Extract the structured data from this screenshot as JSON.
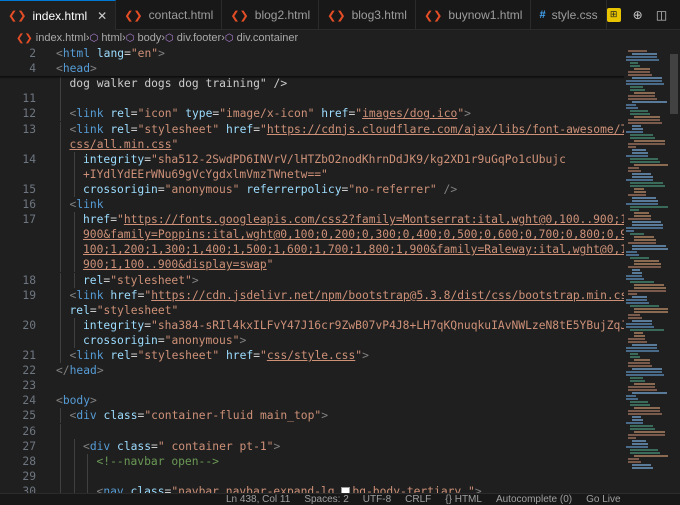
{
  "tabs": [
    {
      "label": "index.html",
      "icon": "html-file-icon",
      "glyph": "❮❯",
      "active": true
    },
    {
      "label": "contact.html",
      "icon": "html-file-icon",
      "glyph": "❮❯",
      "active": false
    },
    {
      "label": "blog2.html",
      "icon": "html-file-icon",
      "glyph": "❮❯",
      "active": false
    },
    {
      "label": "blog3.html",
      "icon": "html-file-icon",
      "glyph": "❮❯",
      "active": false
    },
    {
      "label": "buynow1.html",
      "icon": "html-file-icon",
      "glyph": "❮❯",
      "active": false
    },
    {
      "label": "style.css",
      "icon": "css-file-icon",
      "glyph": "#",
      "active": false
    }
  ],
  "tab_actions": {
    "highlight_glyph": "⊞",
    "globe_glyph": "⊕",
    "split_glyph": "◫",
    "more_glyph": "···"
  },
  "breadcrumb": [
    "index.html",
    "html",
    "body",
    "div.footer",
    "div.container"
  ],
  "status": {
    "position": "Ln 438, Col 11",
    "spaces": "Spaces: 2",
    "encoding": "UTF-8",
    "eol": "CRLF",
    "language": "{} HTML",
    "autocomplete": "Autocomplete (0)",
    "golive": "Go Live"
  },
  "colors": {
    "accent": "#0078d4",
    "tag": "#569cd6",
    "attr": "#9cdcfe",
    "string": "#ce9178",
    "comment": "#6a9955"
  },
  "lines": [
    {
      "n": "2",
      "indent": 0,
      "sticky": true,
      "tokens": [
        [
          "p",
          "<"
        ],
        [
          "t",
          "html"
        ],
        [
          "w",
          " "
        ],
        [
          "a",
          "lang"
        ],
        [
          "w",
          "="
        ],
        [
          "s",
          "\"en\""
        ],
        [
          "p",
          ">"
        ]
      ]
    },
    {
      "n": "4",
      "indent": 0,
      "sticky": true,
      "tokens": [
        [
          "p",
          "<"
        ],
        [
          "t",
          "head"
        ],
        [
          "p",
          ">"
        ]
      ]
    },
    {
      "n": "",
      "indent": 1,
      "tokens": [
        [
          "w",
          "dog walker dogs dog training\" />"
        ]
      ]
    },
    {
      "n": "11",
      "indent": 1,
      "tokens": []
    },
    {
      "n": "12",
      "indent": 1,
      "tokens": [
        [
          "p",
          "<"
        ],
        [
          "t",
          "link"
        ],
        [
          "w",
          " "
        ],
        [
          "a",
          "rel"
        ],
        [
          "w",
          "="
        ],
        [
          "s",
          "\"icon\""
        ],
        [
          "w",
          " "
        ],
        [
          "a",
          "type"
        ],
        [
          "w",
          "="
        ],
        [
          "s",
          "\"image/x-icon\""
        ],
        [
          "w",
          " "
        ],
        [
          "a",
          "href"
        ],
        [
          "w",
          "="
        ],
        [
          "s",
          "\""
        ],
        [
          "u",
          "images/dog.ico"
        ],
        [
          "s",
          "\""
        ],
        [
          "p",
          ">"
        ]
      ]
    },
    {
      "n": "13",
      "indent": 1,
      "tokens": [
        [
          "p",
          "<"
        ],
        [
          "t",
          "link"
        ],
        [
          "w",
          " "
        ],
        [
          "a",
          "rel"
        ],
        [
          "w",
          "="
        ],
        [
          "s",
          "\"stylesheet\""
        ],
        [
          "w",
          " "
        ],
        [
          "a",
          "href"
        ],
        [
          "w",
          "="
        ],
        [
          "s",
          "\""
        ],
        [
          "u",
          "https://cdnjs.cloudflare.com/ajax/libs/font-awesome/7.0.1/"
        ]
      ]
    },
    {
      "n": "",
      "indent": 1,
      "tokens": [
        [
          "u",
          "css/all.min.css"
        ],
        [
          "s",
          "\""
        ]
      ]
    },
    {
      "n": "14",
      "indent": 2,
      "tokens": [
        [
          "a",
          "integrity"
        ],
        [
          "w",
          "="
        ],
        [
          "s",
          "\"sha512-2SwdPD6INVrV/lHTZbO2nodKhrnDdJK9/kg2XD1r9uGqPo1cUbujc"
        ]
      ]
    },
    {
      "n": "",
      "indent": 2,
      "tokens": [
        [
          "s",
          "+IYdlYdEErWNu69gVcYgdxlmVmzTWnetw==\""
        ]
      ]
    },
    {
      "n": "15",
      "indent": 2,
      "tokens": [
        [
          "a",
          "crossorigin"
        ],
        [
          "w",
          "="
        ],
        [
          "s",
          "\"anonymous\""
        ],
        [
          "w",
          " "
        ],
        [
          "a",
          "referrerpolicy"
        ],
        [
          "w",
          "="
        ],
        [
          "s",
          "\"no-referrer\""
        ],
        [
          "w",
          " "
        ],
        [
          "p",
          "/>"
        ]
      ]
    },
    {
      "n": "16",
      "indent": 1,
      "tokens": [
        [
          "p",
          "<"
        ],
        [
          "t",
          "link"
        ]
      ]
    },
    {
      "n": "17",
      "indent": 2,
      "tokens": [
        [
          "a",
          "href"
        ],
        [
          "w",
          "="
        ],
        [
          "s",
          "\""
        ],
        [
          "u",
          "https://fonts.googleapis.com/css2?family=Montserrat:ital,wght@0,100..900;1,100.."
        ]
      ]
    },
    {
      "n": "",
      "indent": 2,
      "tokens": [
        [
          "u",
          "900&family=Poppins:ital,wght@0,100;0,200;0,300;0,400;0,500;0,600;0,700;0,800;0,900;1,"
        ]
      ]
    },
    {
      "n": "",
      "indent": 2,
      "tokens": [
        [
          "u",
          "100;1,200;1,300;1,400;1,500;1,600;1,700;1,800;1,900&family=Raleway:ital,wght@0,100.."
        ]
      ]
    },
    {
      "n": "",
      "indent": 2,
      "tokens": [
        [
          "u",
          "900;1,100..900&display=swap"
        ],
        [
          "s",
          "\""
        ]
      ]
    },
    {
      "n": "18",
      "indent": 2,
      "tokens": [
        [
          "a",
          "rel"
        ],
        [
          "w",
          "="
        ],
        [
          "s",
          "\"stylesheet\""
        ],
        [
          "p",
          ">"
        ]
      ]
    },
    {
      "n": "19",
      "indent": 1,
      "tokens": [
        [
          "p",
          "<"
        ],
        [
          "t",
          "link"
        ],
        [
          "w",
          " "
        ],
        [
          "a",
          "href"
        ],
        [
          "w",
          "="
        ],
        [
          "s",
          "\""
        ],
        [
          "u",
          "https://cdn.jsdelivr.net/npm/bootstrap@5.3.8/dist/css/bootstrap.min.css"
        ],
        [
          "s",
          "\""
        ]
      ]
    },
    {
      "n": "",
      "indent": 1,
      "tokens": [
        [
          "a",
          "rel"
        ],
        [
          "w",
          "="
        ],
        [
          "s",
          "\"stylesheet\""
        ]
      ]
    },
    {
      "n": "20",
      "indent": 2,
      "tokens": [
        [
          "a",
          "integrity"
        ],
        [
          "w",
          "="
        ],
        [
          "s",
          "\"sha384-sRIl4kxILFvY47J16cr9ZwB07vP4J8+LH7qKQnuqkuIAvNWLzeN8tE5YBujZqJLB\""
        ]
      ]
    },
    {
      "n": "",
      "indent": 2,
      "tokens": [
        [
          "a",
          "crossorigin"
        ],
        [
          "w",
          "="
        ],
        [
          "s",
          "\"anonymous\""
        ],
        [
          "p",
          ">"
        ]
      ]
    },
    {
      "n": "21",
      "indent": 1,
      "tokens": [
        [
          "p",
          "<"
        ],
        [
          "t",
          "link"
        ],
        [
          "w",
          " "
        ],
        [
          "a",
          "rel"
        ],
        [
          "w",
          "="
        ],
        [
          "s",
          "\"stylesheet\""
        ],
        [
          "w",
          " "
        ],
        [
          "a",
          "href"
        ],
        [
          "w",
          "="
        ],
        [
          "s",
          "\""
        ],
        [
          "u",
          "css/style.css"
        ],
        [
          "s",
          "\""
        ],
        [
          "p",
          ">"
        ]
      ]
    },
    {
      "n": "22",
      "indent": 0,
      "tokens": [
        [
          "p",
          "</"
        ],
        [
          "t",
          "head"
        ],
        [
          "p",
          ">"
        ]
      ]
    },
    {
      "n": "23",
      "indent": 0,
      "tokens": []
    },
    {
      "n": "24",
      "indent": 0,
      "tokens": [
        [
          "p",
          "<"
        ],
        [
          "t",
          "body"
        ],
        [
          "p",
          ">"
        ]
      ]
    },
    {
      "n": "25",
      "indent": 1,
      "tokens": [
        [
          "p",
          "<"
        ],
        [
          "t",
          "div"
        ],
        [
          "w",
          " "
        ],
        [
          "a",
          "class"
        ],
        [
          "w",
          "="
        ],
        [
          "s",
          "\"container-fluid main_top\""
        ],
        [
          "p",
          ">"
        ]
      ]
    },
    {
      "n": "26",
      "indent": 1,
      "tokens": []
    },
    {
      "n": "27",
      "indent": 2,
      "tokens": [
        [
          "p",
          "<"
        ],
        [
          "t",
          "div"
        ],
        [
          "w",
          " "
        ],
        [
          "a",
          "class"
        ],
        [
          "w",
          "="
        ],
        [
          "s",
          "\" container pt-1\""
        ],
        [
          "p",
          ">"
        ]
      ]
    },
    {
      "n": "28",
      "indent": 3,
      "tokens": [
        [
          "c",
          "<!--navbar open-->"
        ]
      ]
    },
    {
      "n": "29",
      "indent": 3,
      "tokens": []
    },
    {
      "n": "30",
      "indent": 3,
      "tokens": [
        [
          "p",
          "<"
        ],
        [
          "t",
          "nav"
        ],
        [
          "w",
          " "
        ],
        [
          "a",
          "class"
        ],
        [
          "w",
          "="
        ],
        [
          "s",
          "\"navbar navbar-expand-lg "
        ],
        [
          "sq",
          ""
        ],
        [
          "s",
          "bg-body-tertiary \""
        ],
        [
          "p",
          ">"
        ]
      ]
    }
  ]
}
